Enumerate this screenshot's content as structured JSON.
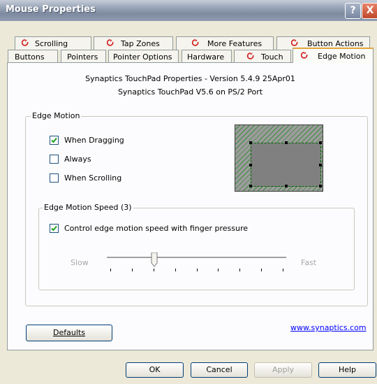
{
  "window": {
    "title": "Mouse Properties"
  },
  "titlebar_buttons": {
    "help": "?",
    "close": "X"
  },
  "tabs_back": [
    {
      "label": "Scrolling"
    },
    {
      "label": "Tap Zones"
    },
    {
      "label": "More Features"
    },
    {
      "label": "Button Actions"
    }
  ],
  "tabs_front": [
    {
      "label": "Buttons"
    },
    {
      "label": "Pointers"
    },
    {
      "label": "Pointer Options"
    },
    {
      "label": "Hardware"
    },
    {
      "label": "Touch"
    },
    {
      "label": "Edge Motion"
    }
  ],
  "header": {
    "line1": "Synaptics TouchPad Properties - Version 5.4.9 25Apr01",
    "line2": "Synaptics TouchPad V5.6 on PS/2 Port"
  },
  "edge_motion": {
    "group_label": "Edge Motion",
    "options": [
      {
        "label": "When Dragging",
        "checked": true
      },
      {
        "label": "Always",
        "checked": false
      },
      {
        "label": "When Scrolling",
        "checked": false
      }
    ]
  },
  "speed": {
    "group_label": "Edge Motion Speed (3)",
    "finger_pressure_label": "Control edge motion speed with finger pressure",
    "finger_pressure_checked": true,
    "slow_label": "Slow",
    "fast_label": "Fast",
    "tick_count": 9,
    "value_index": 2
  },
  "buttons": {
    "defaults": "Defaults",
    "ok": "OK",
    "cancel": "Cancel",
    "apply": "Apply",
    "help": "Help"
  },
  "link": {
    "text": "www.synaptics.com"
  },
  "colors": {
    "tab_icon": "#d01818",
    "active_tab_top": "#e6a43c",
    "link": "#0000ff"
  }
}
